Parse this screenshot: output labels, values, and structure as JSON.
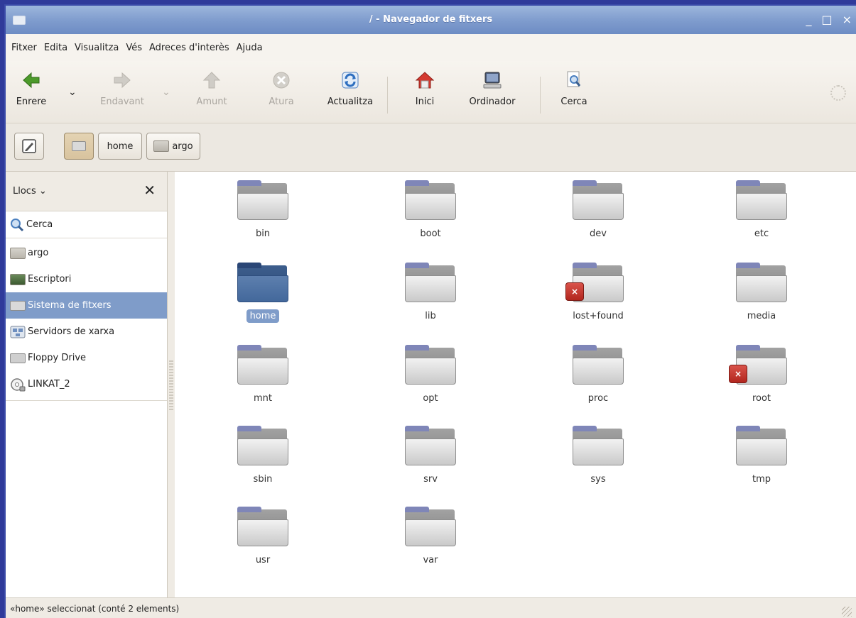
{
  "window": {
    "title": "/ - Navegador de fitxers",
    "controls": [
      "_",
      "□",
      "×"
    ]
  },
  "menu": [
    "Fitxer",
    "Edita",
    "Visualitza",
    "Vés",
    "Adreces d'interès",
    "Ajuda"
  ],
  "toolbar": {
    "back": "Enrere",
    "forward": "Endavant",
    "up": "Amunt",
    "stop": "Atura",
    "reload": "Actualitza",
    "home": "Inici",
    "computer": "Ordinador",
    "search": "Cerca"
  },
  "location": {
    "crumb_home": "home",
    "crumb_argo": "argo"
  },
  "sidebar": {
    "header": "Llocs",
    "search": "Cerca",
    "items": [
      {
        "label": "argo",
        "icon": "home-folder-icon"
      },
      {
        "label": "Escriptori",
        "icon": "desktop-icon"
      },
      {
        "label": "Sistema de fitxers",
        "icon": "filesystem-icon",
        "selected": true
      },
      {
        "label": "Servidors de xarxa",
        "icon": "network-icon"
      },
      {
        "label": "Floppy Drive",
        "icon": "floppy-icon"
      },
      {
        "label": "LINKAT_2",
        "icon": "cdrom-icon"
      }
    ]
  },
  "files": [
    {
      "name": "bin"
    },
    {
      "name": "boot"
    },
    {
      "name": "dev"
    },
    {
      "name": "etc"
    },
    {
      "name": "home",
      "selected": true
    },
    {
      "name": "lib"
    },
    {
      "name": "lost+found",
      "locked": true
    },
    {
      "name": "media"
    },
    {
      "name": "mnt"
    },
    {
      "name": "opt"
    },
    {
      "name": "proc"
    },
    {
      "name": "root",
      "locked": true
    },
    {
      "name": "sbin"
    },
    {
      "name": "srv"
    },
    {
      "name": "sys"
    },
    {
      "name": "tmp"
    },
    {
      "name": "usr"
    },
    {
      "name": "var"
    }
  ],
  "status": "«home» seleccionat (conté 2 elements)",
  "colors": {
    "selection": "#7f9cc9",
    "titlebar": "#7e9bcd"
  }
}
